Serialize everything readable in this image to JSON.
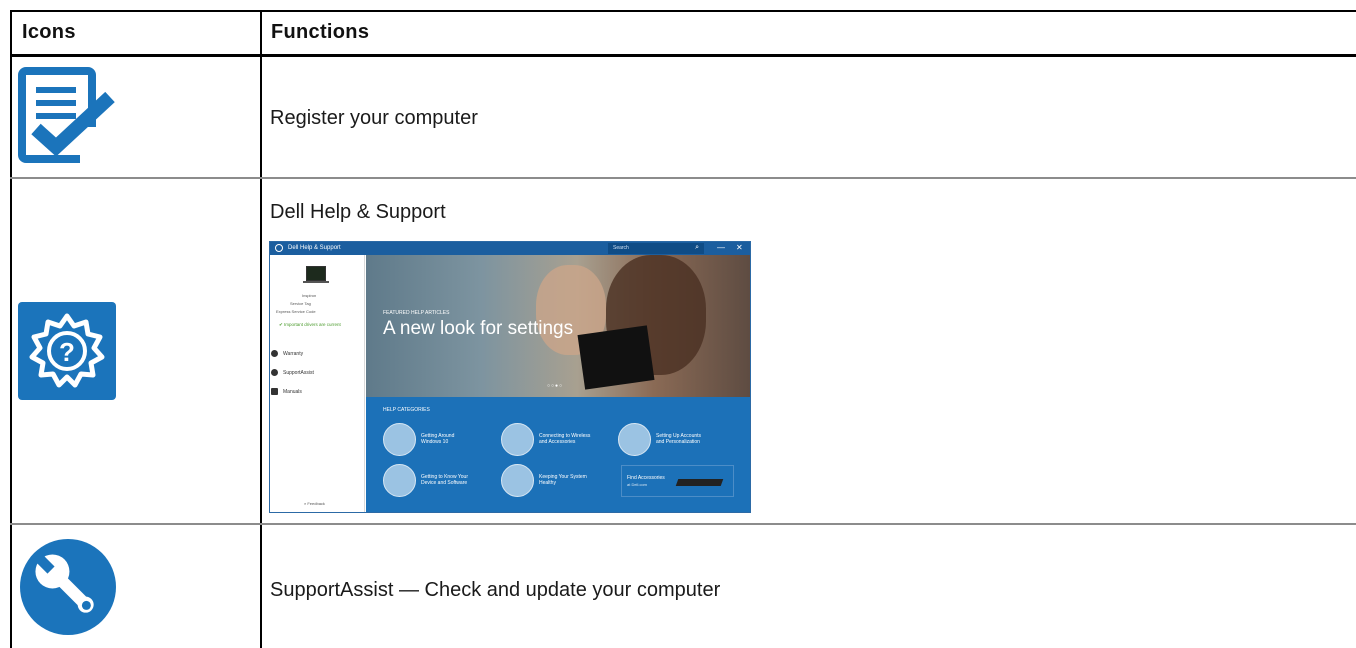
{
  "table": {
    "headers": {
      "icons": "Icons",
      "functions": "Functions"
    },
    "rows": [
      {
        "icon": "register-checklist-icon",
        "function": "Register your computer"
      },
      {
        "icon": "help-gear-icon",
        "function": "Dell Help & Support"
      },
      {
        "icon": "wrench-icon",
        "function": "SupportAssist — Check and update your computer"
      }
    ]
  },
  "screenshot": {
    "title": "Dell Help & Support",
    "search_placeholder": "Search",
    "minimize": "—",
    "close": "✕",
    "sidebar": {
      "model": "Inspiron",
      "service_tag": "Service Tag",
      "express_code": "Express Service Code",
      "status": "Important drivers are current",
      "items": [
        "Warranty",
        "SupportAssist",
        "Manuals"
      ],
      "feedback": "Feedback"
    },
    "hero": {
      "featured": "FEATURED HELP ARTICLES",
      "headline": "A new look for settings"
    },
    "categories": {
      "heading": "HELP CATEGORIES",
      "items": [
        "Getting Around\nWindows 10",
        "Connecting to Wireless\nand Accessories",
        "Setting Up Accounts\nand Personalization",
        "Getting to Know Your\nDevice and Software",
        "Keeping Your System\nHealthy"
      ],
      "accessories": {
        "title": "Find Accessories",
        "sub": "at Dell.com"
      }
    }
  },
  "colors": {
    "dell_blue": "#1b74bb",
    "header_bar": "#1b5e9f"
  }
}
